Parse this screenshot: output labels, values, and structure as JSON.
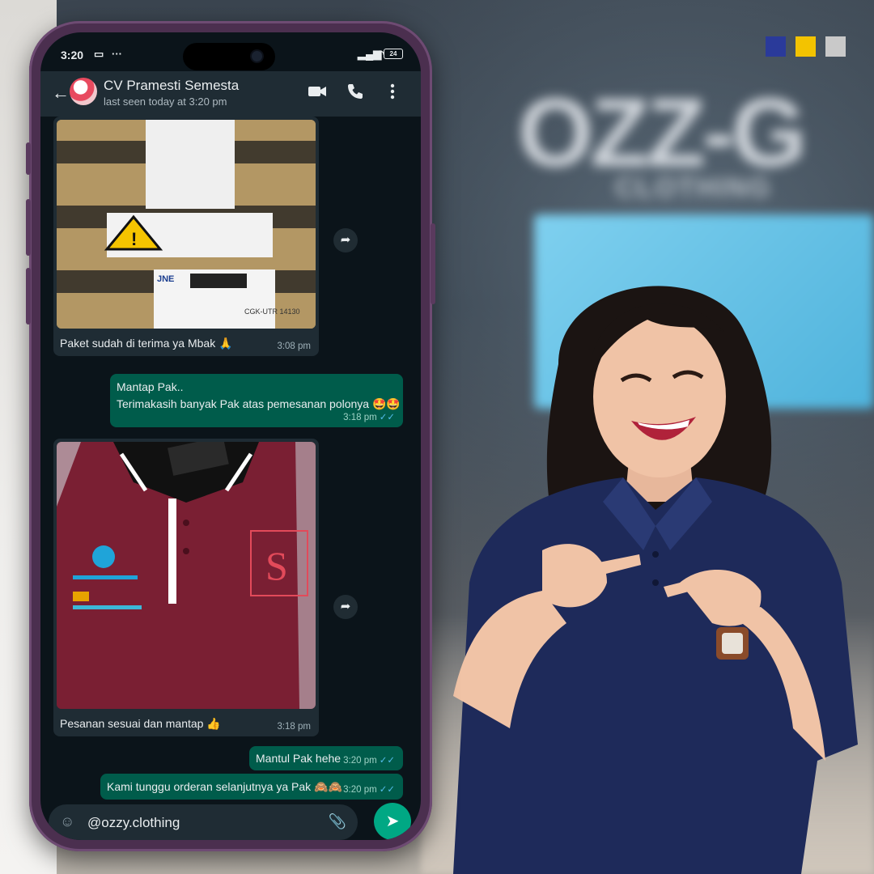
{
  "status": {
    "time": "3:20",
    "battery": "24"
  },
  "chat_header": {
    "contact_name": "CV Pramesti Semesta",
    "last_seen": "last seen today at 3:20 pm"
  },
  "photo_labels": {
    "package_courier": "JNE",
    "package_code": "CGK-UTR 14130"
  },
  "messages": [
    {
      "direction": "in",
      "type": "image",
      "text": "Paket sudah di terima ya Mbak 🙏",
      "time": "3:08 pm"
    },
    {
      "direction": "out",
      "type": "text",
      "line1": "Mantap Pak..",
      "line2": "Terimakasih banyak Pak atas pemesanan polonya 🤩🤩",
      "time": "3:18 pm"
    },
    {
      "direction": "in",
      "type": "image",
      "text": "Pesanan sesuai dan mantap 👍",
      "time": "3:18 pm"
    },
    {
      "direction": "out",
      "type": "text",
      "text": "Mantul Pak hehe",
      "time": "3:20 pm"
    },
    {
      "direction": "out",
      "type": "text",
      "text": "Kami tunggu orderan selanjutnya ya Pak 🙈🙈",
      "time": "3:20 pm"
    }
  ],
  "composer": {
    "value": "@ozzy.clothing"
  },
  "background": {
    "brand_big": "OZZ-G",
    "brand_small": "CLOTHING"
  },
  "colors": {
    "square1": "#2a3a9a",
    "square2": "#f3c300",
    "square3": "#c9c9c9",
    "wa_header": "#1f2c34",
    "wa_outgoing": "#005c4b",
    "wa_send": "#00a884"
  }
}
